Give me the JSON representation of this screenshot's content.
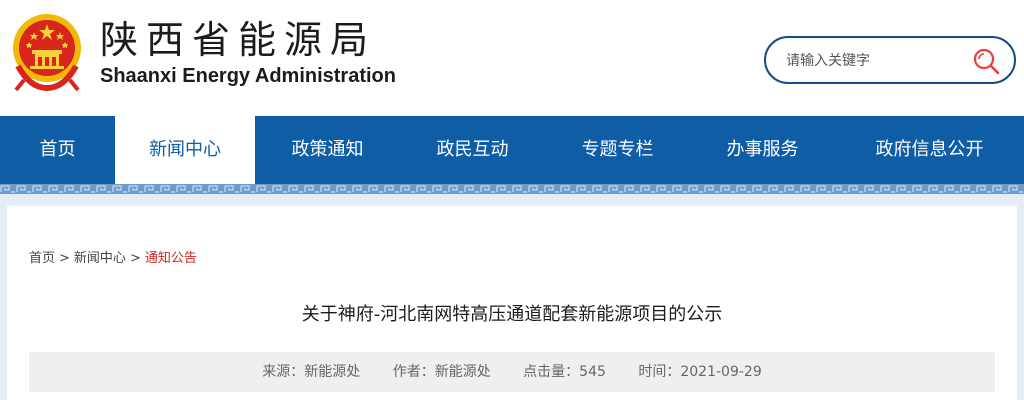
{
  "header": {
    "title_cn": "陕西省能源局",
    "title_en": "Shaanxi Energy Administration",
    "emblem_icon": "national-emblem-icon"
  },
  "search": {
    "placeholder": "请输入关键字",
    "icon": "search-icon"
  },
  "nav": {
    "items": [
      {
        "label": "首页"
      },
      {
        "label": "新闻中心"
      },
      {
        "label": "政策通知"
      },
      {
        "label": "政民互动"
      },
      {
        "label": "专题专栏"
      },
      {
        "label": "办事服务"
      },
      {
        "label": "政府信息公开"
      }
    ],
    "active": "新闻中心"
  },
  "breadcrumb": {
    "items": [
      {
        "label": "首页"
      },
      {
        "label": "新闻中心"
      },
      {
        "label": "通知公告"
      }
    ],
    "separator": ">"
  },
  "article": {
    "title": "关于神府-河北南网特高压通道配套新能源项目的公示",
    "meta": {
      "source_label": "来源：",
      "source_value": "新能源处",
      "author_label": "作者：",
      "author_value": "新能源处",
      "views_label": "点击量：",
      "views_value": "545",
      "time_label": "时间：",
      "time_value": "2021-09-29"
    }
  },
  "colors": {
    "nav_bg": "#0e5da5",
    "accent_red": "#d2261e",
    "search_border": "#1a4a8c",
    "page_bg": "#e3eef8"
  }
}
